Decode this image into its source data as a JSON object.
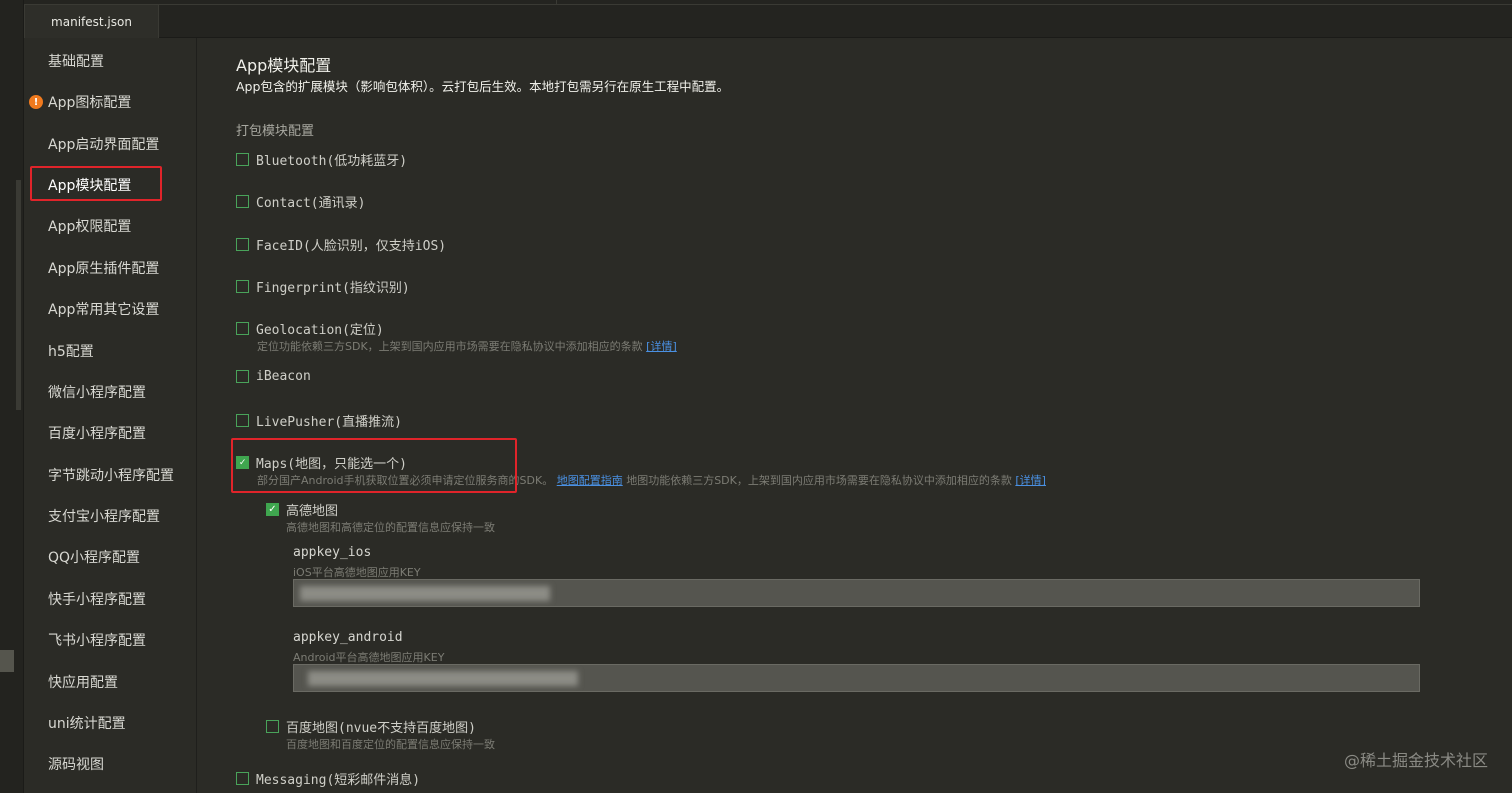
{
  "tab": {
    "label": "manifest.json"
  },
  "sidebar": {
    "items": [
      {
        "label": "基础配置"
      },
      {
        "label": "App图标配置",
        "warning": "!"
      },
      {
        "label": "App启动界面配置"
      },
      {
        "label": "App模块配置",
        "active": true
      },
      {
        "label": "App权限配置"
      },
      {
        "label": "App原生插件配置"
      },
      {
        "label": "App常用其它设置"
      },
      {
        "label": "h5配置"
      },
      {
        "label": "微信小程序配置"
      },
      {
        "label": "百度小程序配置"
      },
      {
        "label": "字节跳动小程序配置"
      },
      {
        "label": "支付宝小程序配置"
      },
      {
        "label": "QQ小程序配置"
      },
      {
        "label": "快手小程序配置"
      },
      {
        "label": "飞书小程序配置"
      },
      {
        "label": "快应用配置"
      },
      {
        "label": "uni统计配置"
      },
      {
        "label": "源码视图"
      }
    ]
  },
  "main": {
    "title": "App模块配置",
    "subtitle": "App包含的扩展模块（影响包体积）。云打包后生效。本地打包需另行在原生工程中配置。",
    "section_label": "打包模块配置",
    "modules": {
      "bluetooth": {
        "label": "Bluetooth(低功耗蓝牙)",
        "checked": false
      },
      "contact": {
        "label": "Contact(通讯录)",
        "checked": false
      },
      "faceid": {
        "label": "FaceID(人脸识别，仅支持iOS)",
        "checked": false
      },
      "fingerprint": {
        "label": "Fingerprint(指纹识别)",
        "checked": false
      },
      "geolocation": {
        "label": "Geolocation(定位)",
        "checked": false,
        "desc": "定位功能依赖三方SDK，上架到国内应用市场需要在隐私协议中添加相应的条款",
        "link": "[详情]"
      },
      "ibeacon": {
        "label": "iBeacon",
        "checked": false
      },
      "livepusher": {
        "label": "LivePusher(直播推流)",
        "checked": false
      },
      "maps": {
        "label": "Maps(地图，只能选一个)",
        "checked": true,
        "desc_a": "部分国产Android手机获取位置必须申请定位服务商的SDK。",
        "link_guide": "地图配置指南",
        "desc_b": "地图功能依赖三方SDK，上架到国内应用市场需要在隐私协议中添加相应的条款",
        "link": "[详情]",
        "amap": {
          "label": "高德地图",
          "checked": true,
          "desc": "高德地图和高德定位的配置信息应保持一致",
          "ios_key_label": "appkey_ios",
          "ios_key_desc": "iOS平台高德地图应用KEY",
          "android_key_label": "appkey_android",
          "android_key_desc": "Android平台高德地图应用KEY"
        },
        "baidu": {
          "label": "百度地图(nvue不支持百度地图)",
          "checked": false,
          "desc": "百度地图和百度定位的配置信息应保持一致"
        }
      },
      "messaging": {
        "label": "Messaging(短彩邮件消息)",
        "checked": false
      }
    }
  },
  "watermark": "@稀土掘金技术社区",
  "colors": {
    "background": "#2b2b26",
    "checkbox_on": "#3fa64f",
    "highlight": "#e0242a",
    "link": "#4a90e2",
    "warning": "#f07a1e"
  }
}
